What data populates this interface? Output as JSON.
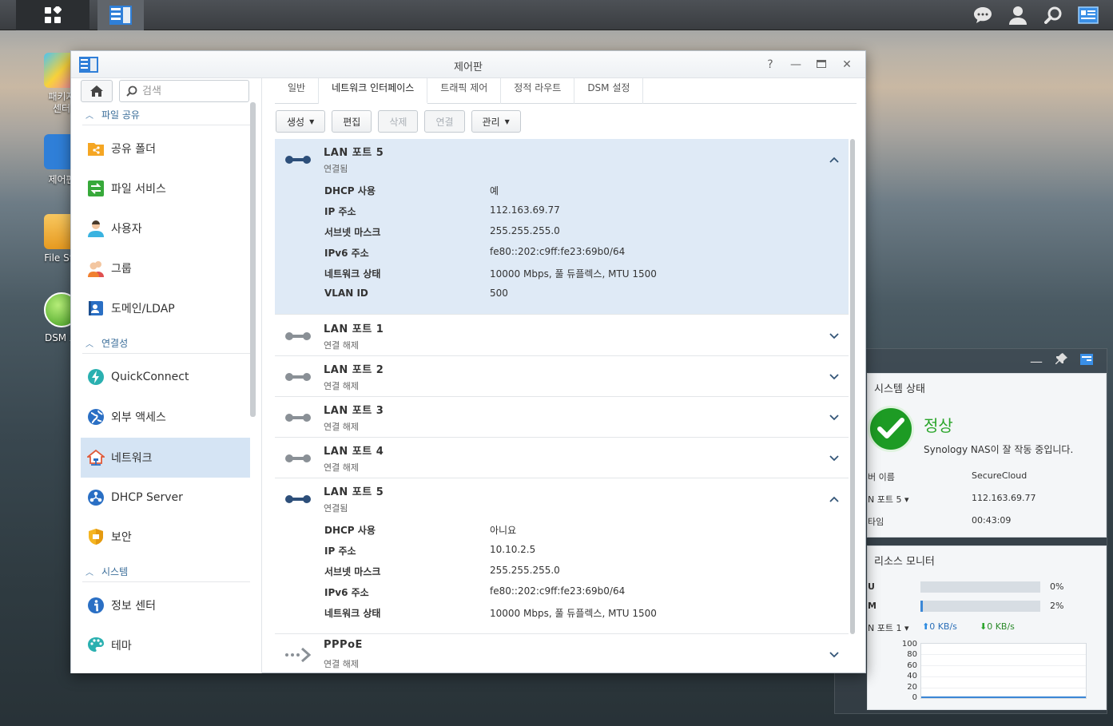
{
  "window": {
    "title": "제어판"
  },
  "desktop": {
    "icons": [
      {
        "label": "패키지\n센터"
      },
      {
        "label": "제어판"
      },
      {
        "label": "File Sta"
      },
      {
        "label": "DSM 도"
      }
    ]
  },
  "sidebar": {
    "search_placeholder": "검색",
    "sections": [
      {
        "label": "파일 공유"
      },
      {
        "label": "연결성"
      },
      {
        "label": "시스템"
      }
    ],
    "items": [
      {
        "label": "공유 폴더"
      },
      {
        "label": "파일 서비스"
      },
      {
        "label": "사용자"
      },
      {
        "label": "그룹"
      },
      {
        "label": "도메인/LDAP"
      },
      {
        "label": "QuickConnect"
      },
      {
        "label": "외부 액세스"
      },
      {
        "label": "네트워크"
      },
      {
        "label": "DHCP Server"
      },
      {
        "label": "보안"
      },
      {
        "label": "정보 센터"
      },
      {
        "label": "테마"
      }
    ]
  },
  "tabs": [
    {
      "label": "일반"
    },
    {
      "label": "네트워크 인터페이스"
    },
    {
      "label": "트래픽 제어"
    },
    {
      "label": "정적 라우트"
    },
    {
      "label": "DSM 설정"
    }
  ],
  "toolbar": {
    "create": "생성",
    "edit": "편집",
    "delete": "삭제",
    "connect": "연결",
    "manage": "관리"
  },
  "ports": [
    {
      "name": "LAN 포트 5",
      "status": "연결됨",
      "details": [
        {
          "k": "DHCP 사용",
          "v": "예"
        },
        {
          "k": "IP 주소",
          "v": "112.163.69.77"
        },
        {
          "k": "서브넷 마스크",
          "v": "255.255.255.0"
        },
        {
          "k": "IPv6 주소",
          "v": "fe80::202:c9ff:fe23:69b0/64"
        },
        {
          "k": "네트워크 상태",
          "v": "10000 Mbps, 풀 듀플렉스, MTU 1500"
        },
        {
          "k": "VLAN ID",
          "v": "500"
        }
      ]
    },
    {
      "name": "LAN 포트 1",
      "status": "연결 해제"
    },
    {
      "name": "LAN 포트 2",
      "status": "연결 해제"
    },
    {
      "name": "LAN 포트 3",
      "status": "연결 해제"
    },
    {
      "name": "LAN 포트 4",
      "status": "연결 해제"
    },
    {
      "name": "LAN 포트 5",
      "status": "연결됨",
      "details": [
        {
          "k": "DHCP 사용",
          "v": "아니요"
        },
        {
          "k": "IP 주소",
          "v": "10.10.2.5"
        },
        {
          "k": "서브넷 마스크",
          "v": "255.255.255.0"
        },
        {
          "k": "IPv6 주소",
          "v": "fe80::202:c9ff:fe23:69b0/64"
        },
        {
          "k": "네트워크 상태",
          "v": "10000 Mbps, 풀 듀플렉스, MTU 1500"
        }
      ]
    },
    {
      "name": "PPPoE",
      "status": "연결 해제"
    }
  ],
  "widgets": {
    "system_status": {
      "title": "시스템 상태",
      "state": "정상",
      "message": "Synology NAS이 잘 작동 중입니다.",
      "rows": [
        {
          "k": "버 이름",
          "v": "SecureCloud"
        },
        {
          "k": "N 포트 5 ▾",
          "v": "112.163.69.77"
        },
        {
          "k": "타임",
          "v": "00:43:09"
        }
      ]
    },
    "resource_monitor": {
      "title": "리소스 모니터",
      "cpu_label": "U",
      "cpu_value": "0%",
      "cpu_fraction": 0.0,
      "ram_label": "M",
      "ram_value": "2%",
      "ram_fraction": 0.02,
      "lan_label": "N 포트 1 ▾",
      "up": "0 KB/s",
      "down": "0 KB/s",
      "y_ticks": [
        "100",
        "80",
        "60",
        "40",
        "20",
        "0"
      ]
    }
  },
  "colors": {
    "accent": "#3b87d6",
    "active_bg": "#d5e4f4",
    "ok_green": "#2aa52a",
    "port_connected": "#2d4f7a",
    "port_disconnected": "#8a9096"
  }
}
